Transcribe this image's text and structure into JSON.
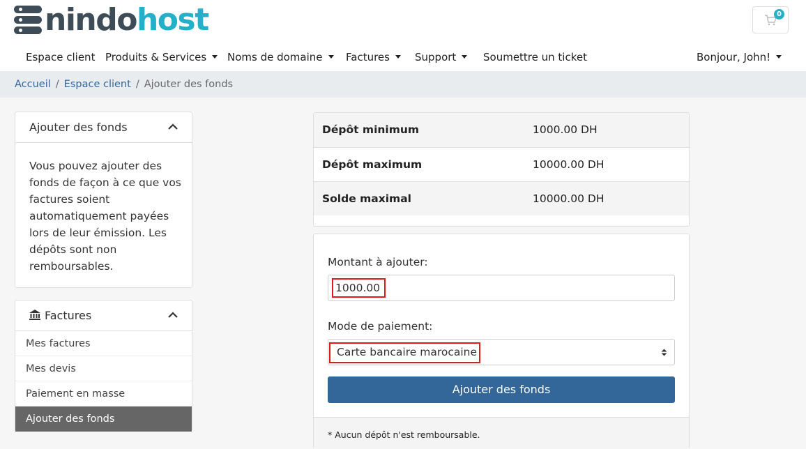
{
  "brand": {
    "logo_part1": "nindo",
    "logo_part2": "host",
    "icon": "server-stack-icon",
    "color_dark": "#3d4c57",
    "color_accent": "#25b0c9"
  },
  "cart": {
    "count": "0",
    "icon": "cart-icon"
  },
  "nav": {
    "items": [
      {
        "label": "Espace client",
        "dropdown": false
      },
      {
        "label": "Produits & Services",
        "dropdown": true
      },
      {
        "label": "Noms de domaine",
        "dropdown": true
      },
      {
        "label": "Factures",
        "dropdown": true
      },
      {
        "label": "Support",
        "dropdown": true
      },
      {
        "label": "Soumettre un ticket",
        "dropdown": false
      }
    ],
    "user_greeting": "Bonjour, John!"
  },
  "breadcrumb": {
    "items": [
      "Accueil",
      "Espace client"
    ],
    "current": "Ajouter des fonds"
  },
  "sidebar": {
    "info_card": {
      "title": "Ajouter des fonds",
      "text": "Vous pouvez ajouter des fonds de façon à ce que vos factures soient automatiquement payées lors de leur émission. Les dépôts sont non remboursables."
    },
    "invoices_card": {
      "title": "Factures",
      "icon": "bank-icon",
      "items": [
        {
          "label": "Mes factures",
          "active": false
        },
        {
          "label": "Mes devis",
          "active": false
        },
        {
          "label": "Paiement en masse",
          "active": false
        },
        {
          "label": "Ajouter des fonds",
          "active": true
        }
      ]
    }
  },
  "limits": {
    "rows": [
      {
        "label": "Dépôt minimum",
        "value": "1000.00 DH"
      },
      {
        "label": "Dépôt maximum",
        "value": "10000.00 DH"
      },
      {
        "label": "Solde maximal",
        "value": "10000.00 DH"
      }
    ]
  },
  "form": {
    "amount_label": "Montant à ajouter:",
    "amount_value": "1000.00",
    "payment_label": "Mode de paiement:",
    "payment_value": "Carte bancaire marocaine",
    "submit_label": "Ajouter des fonds",
    "footer_note": "* Aucun dépôt n'est remboursable.",
    "button_color": "#336699",
    "highlight_color": "#e01919"
  }
}
